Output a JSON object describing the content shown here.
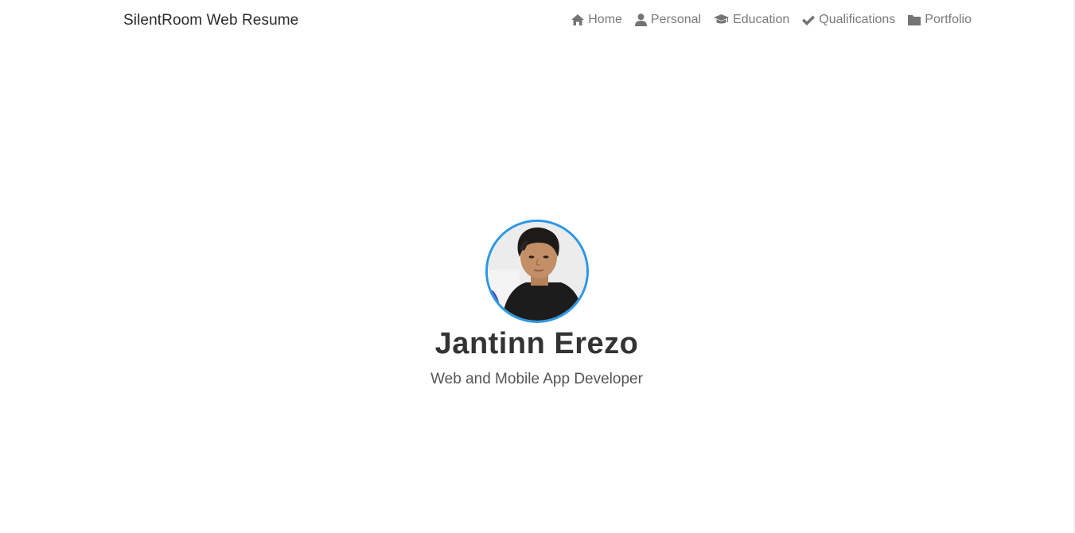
{
  "navbar": {
    "brand": "SilentRoom Web Resume",
    "items": [
      {
        "label": "Home",
        "icon": "home-icon"
      },
      {
        "label": "Personal",
        "icon": "user-icon"
      },
      {
        "label": "Education",
        "icon": "graduation-cap-icon"
      },
      {
        "label": "Qualifications",
        "icon": "check-icon"
      },
      {
        "label": "Portfolio",
        "icon": "folder-icon"
      }
    ]
  },
  "hero": {
    "name": "Jantinn Erezo",
    "subtitle": "Web and Mobile App Developer"
  },
  "colors": {
    "avatar_border": "#2b97e6",
    "name_text": "#333333",
    "nav_text": "#7a7a7a",
    "brand_text": "#2b2b2b"
  }
}
